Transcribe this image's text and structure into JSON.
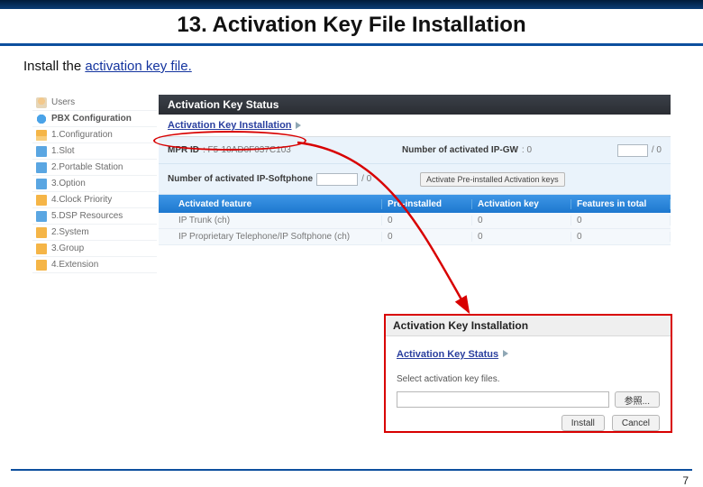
{
  "slide": {
    "title": "13. Activation Key File Installation",
    "subtitle_prefix": "Install the ",
    "subtitle_link": "activation key file.",
    "page": "7"
  },
  "sidebar": {
    "items": [
      {
        "label": "Users"
      },
      {
        "label": "PBX Configuration"
      },
      {
        "label": "1.Configuration"
      },
      {
        "label": "1.Slot"
      },
      {
        "label": "2.Portable Station"
      },
      {
        "label": "3.Option"
      },
      {
        "label": "4.Clock Priority"
      },
      {
        "label": "5.DSP Resources"
      },
      {
        "label": "2.System"
      },
      {
        "label": "3.Group"
      },
      {
        "label": "4.Extension"
      }
    ]
  },
  "main": {
    "title": "Activation Key Status",
    "link": "Activation Key Installation",
    "fields": [
      {
        "label": "MPR ID",
        "value": ": F5-10AD0F037C103"
      },
      {
        "label": "Number of activated IP-GW",
        "value": ": 0",
        "suffix": "/ 0"
      },
      {
        "label": "Number of activated IP-Softphone",
        "value": "/ 0"
      }
    ],
    "activate_btn": "Activate Pre-installed Activation keys",
    "table": {
      "headers": [
        "Activated feature",
        "Pre-installed",
        "Activation key",
        "Features in total"
      ],
      "rows": [
        {
          "feature": "IP Trunk (ch)",
          "pre": "0",
          "key": "0",
          "total": "0"
        },
        {
          "feature": "IP Proprietary Telephone/IP Softphone (ch)",
          "pre": "0",
          "key": "0",
          "total": "0"
        }
      ]
    }
  },
  "panel": {
    "title": "Activation Key Installation",
    "link": "Activation Key Status",
    "instruction": "Select activation key files.",
    "browse": "参照...",
    "install": "Install",
    "cancel": "Cancel"
  }
}
